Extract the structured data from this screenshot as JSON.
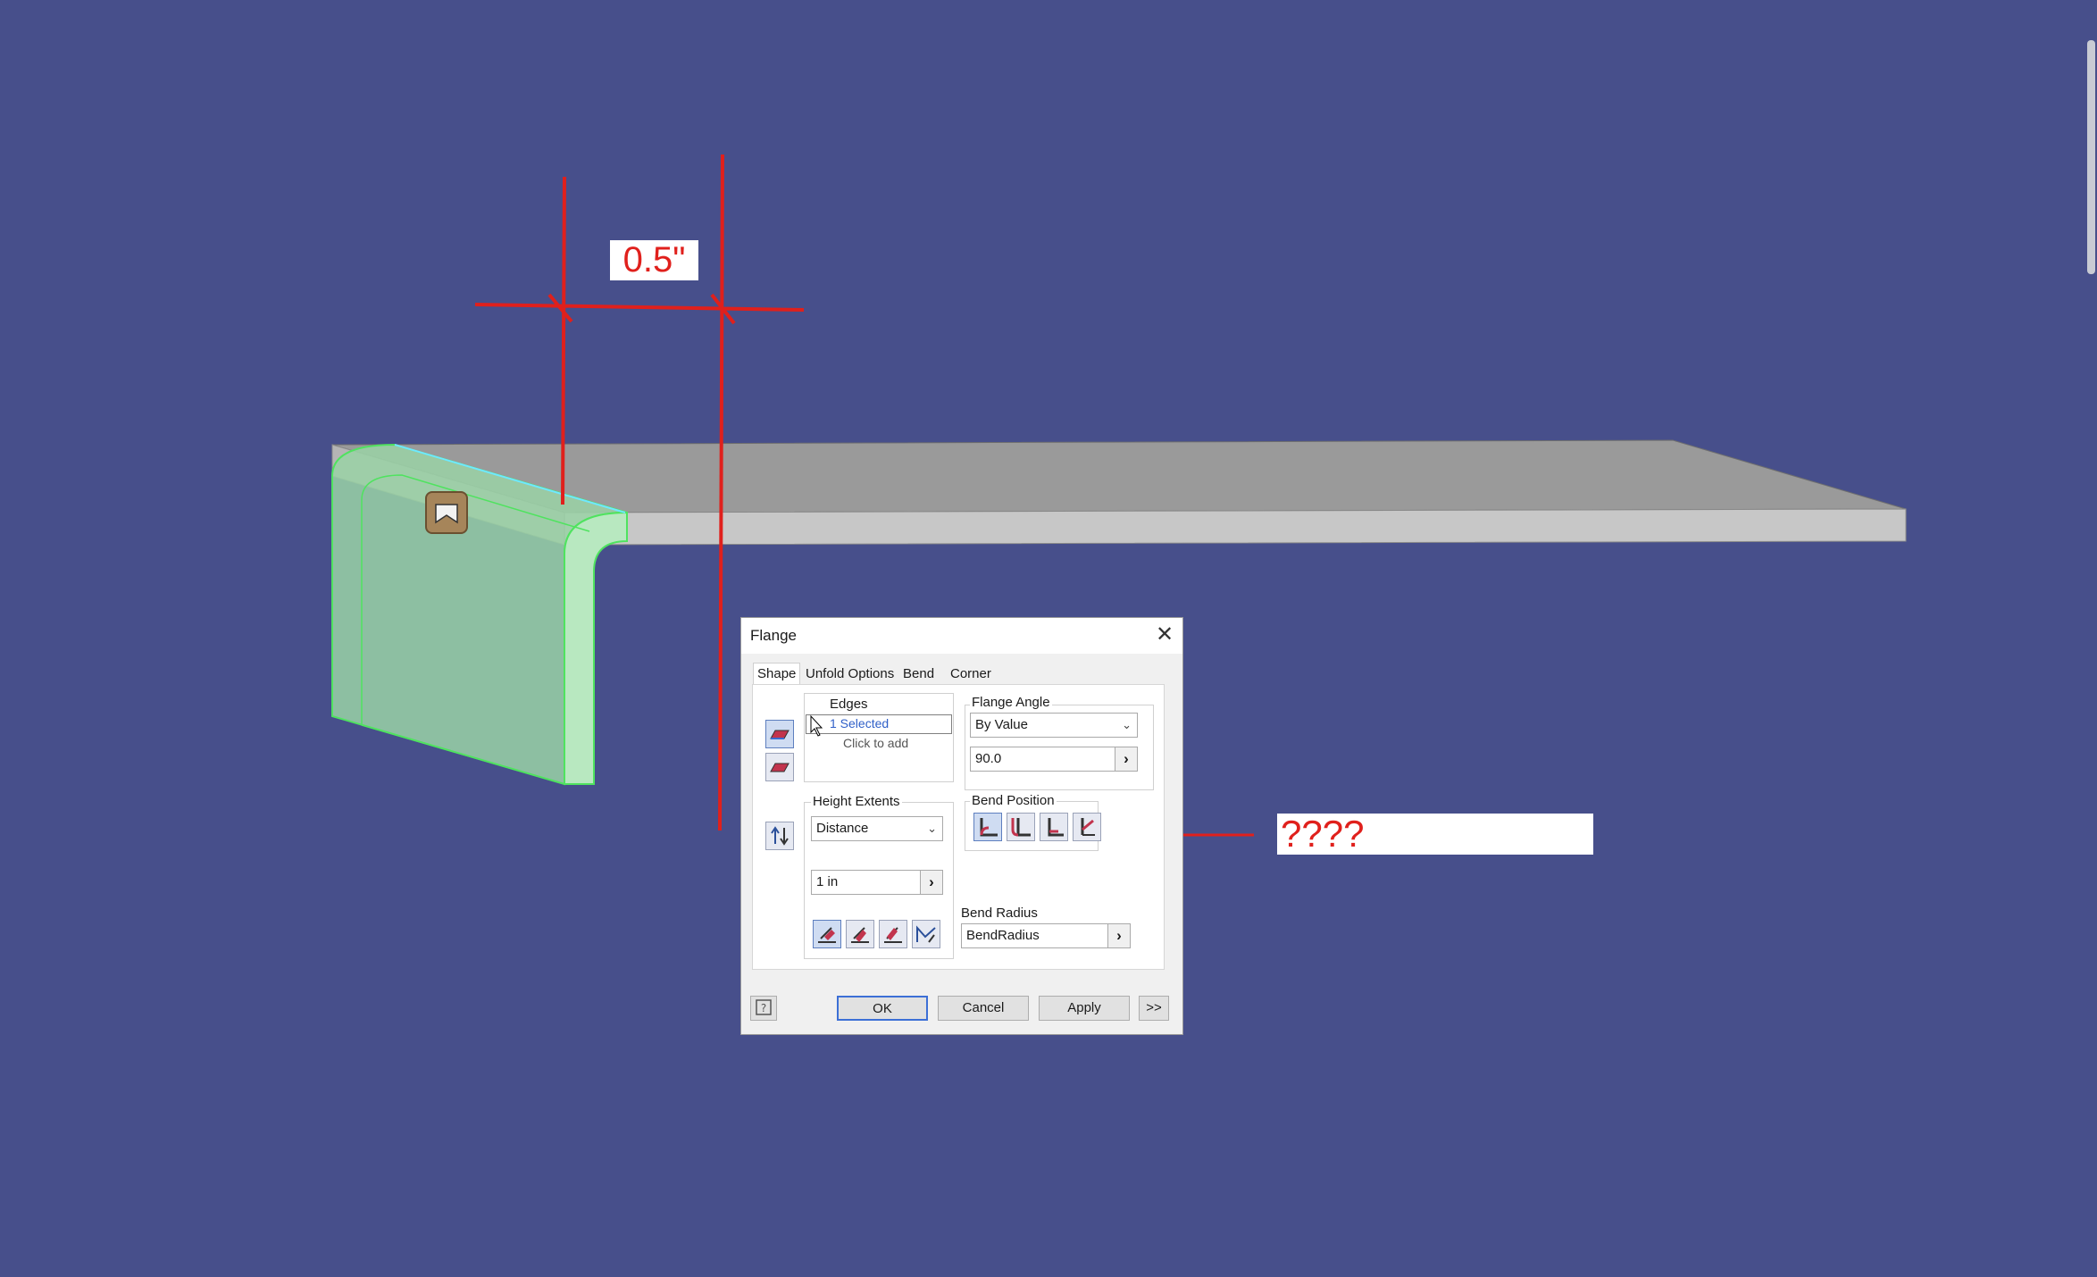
{
  "annotations": {
    "dimension_label": "0.5\"",
    "question_label": "????"
  },
  "dialog": {
    "title": "Flange",
    "close_glyph": "✕",
    "tabs": [
      {
        "label": "Shape",
        "active": true
      },
      {
        "label": "Unfold Options",
        "active": false
      },
      {
        "label": "Bend",
        "active": false
      },
      {
        "label": "Corner",
        "active": false
      }
    ],
    "edges": {
      "label": "Edges",
      "selected": "1 Selected",
      "click_to_add": "Click to add"
    },
    "flange_angle": {
      "label": "Flange Angle",
      "mode": "By Value",
      "value": "90.0"
    },
    "height_extents": {
      "label": "Height Extents",
      "mode": "Distance",
      "value": "1 in"
    },
    "bend_position": {
      "label": "Bend Position"
    },
    "bend_radius": {
      "label": "Bend Radius",
      "value": "BendRadius"
    },
    "buttons": {
      "ok": "OK",
      "cancel": "Cancel",
      "apply": "Apply",
      "more": ">>"
    }
  },
  "colors": {
    "background": "#474f8b",
    "annotation_red": "#e0201c",
    "selection_green": "#7cf08a",
    "plate_top": "#9a9a9a",
    "plate_front": "#c7c7c7"
  }
}
